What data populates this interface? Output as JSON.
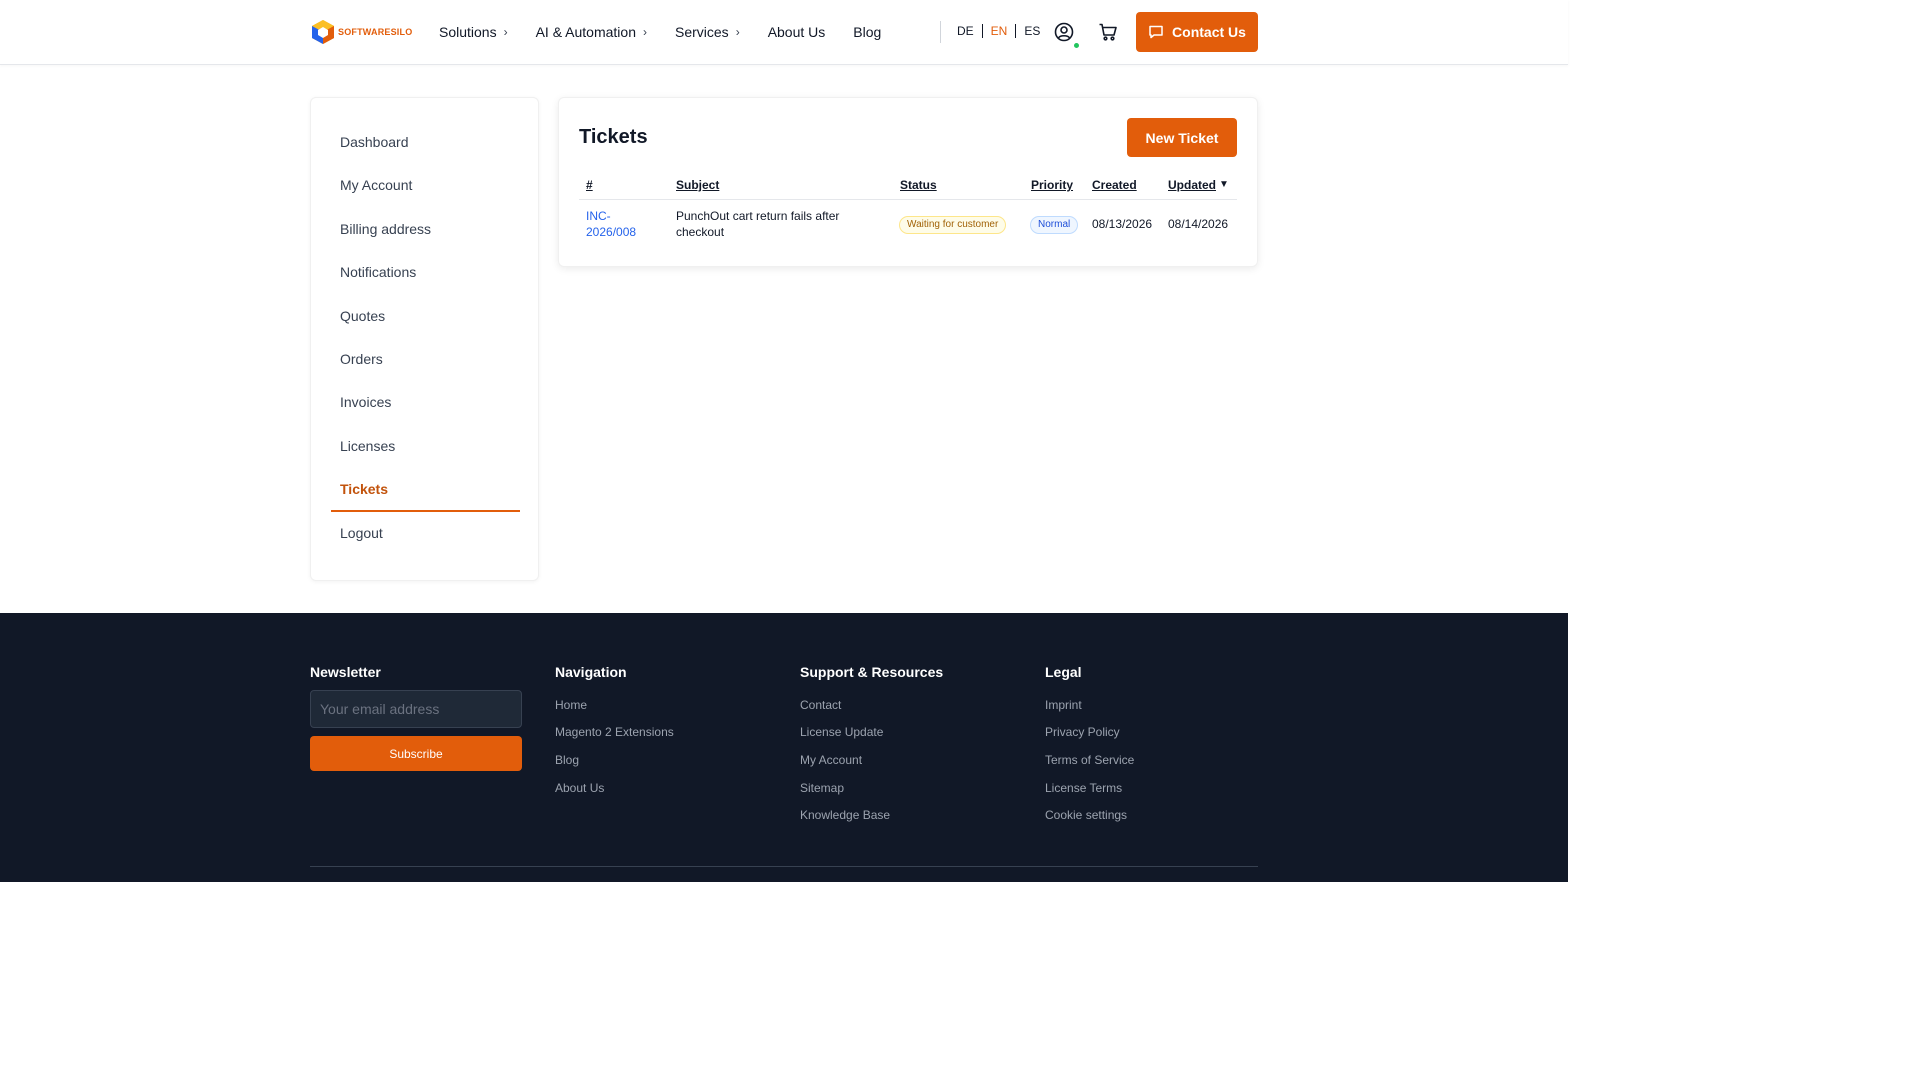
{
  "header": {
    "logo_text": "SOFTWARESILO",
    "nav": [
      {
        "label": "Solutions",
        "has_submenu": true
      },
      {
        "label": "AI & Automation",
        "has_submenu": true
      },
      {
        "label": "Services",
        "has_submenu": true
      },
      {
        "label": "About Us",
        "has_submenu": false
      },
      {
        "label": "Blog",
        "has_submenu": false
      }
    ],
    "languages": [
      "DE",
      "EN",
      "ES"
    ],
    "active_language": "EN",
    "contact_label": "Contact Us"
  },
  "sidebar": {
    "items": [
      {
        "label": "Dashboard"
      },
      {
        "label": "My Account"
      },
      {
        "label": "Billing address"
      },
      {
        "label": "Notifications"
      },
      {
        "label": "Quotes"
      },
      {
        "label": "Orders"
      },
      {
        "label": "Invoices"
      },
      {
        "label": "Licenses"
      },
      {
        "label": "Tickets",
        "active": true
      },
      {
        "label": "Logout"
      }
    ]
  },
  "tickets": {
    "title": "Tickets",
    "new_ticket_label": "New Ticket",
    "columns": [
      "#",
      "Subject",
      "Status",
      "Priority",
      "Created",
      "Updated"
    ],
    "sort_indicator": "▼",
    "rows": [
      {
        "id_line1": "INC-",
        "id_line2": "2026/008",
        "subject_line1": "PunchOut cart return fails after",
        "subject_line2": "checkout",
        "status": "Waiting for customer",
        "priority": "Normal",
        "created": "08/13/2026",
        "updated": "08/14/2026"
      }
    ]
  },
  "footer": {
    "newsletter": {
      "title": "Newsletter",
      "placeholder": "Your email address",
      "subscribe_label": "Subscribe"
    },
    "navigation": {
      "title": "Navigation",
      "links": [
        "Home",
        "Magento 2 Extensions",
        "Blog",
        "About Us"
      ]
    },
    "support": {
      "title": "Support & Resources",
      "links": [
        "Contact",
        "License Update",
        "My Account",
        "Sitemap",
        "Knowledge Base"
      ]
    },
    "legal": {
      "title": "Legal",
      "links": [
        "Imprint",
        "Privacy Policy",
        "Terms of Service",
        "License Terms",
        "Cookie settings"
      ]
    }
  },
  "colors": {
    "accent": "#e25d0b",
    "footer_bg": "#111827",
    "link_blue": "#2563eb"
  },
  "icons": {
    "user": "user-circle-icon",
    "cart": "cart-icon",
    "contact": "chat-bubble-icon"
  }
}
